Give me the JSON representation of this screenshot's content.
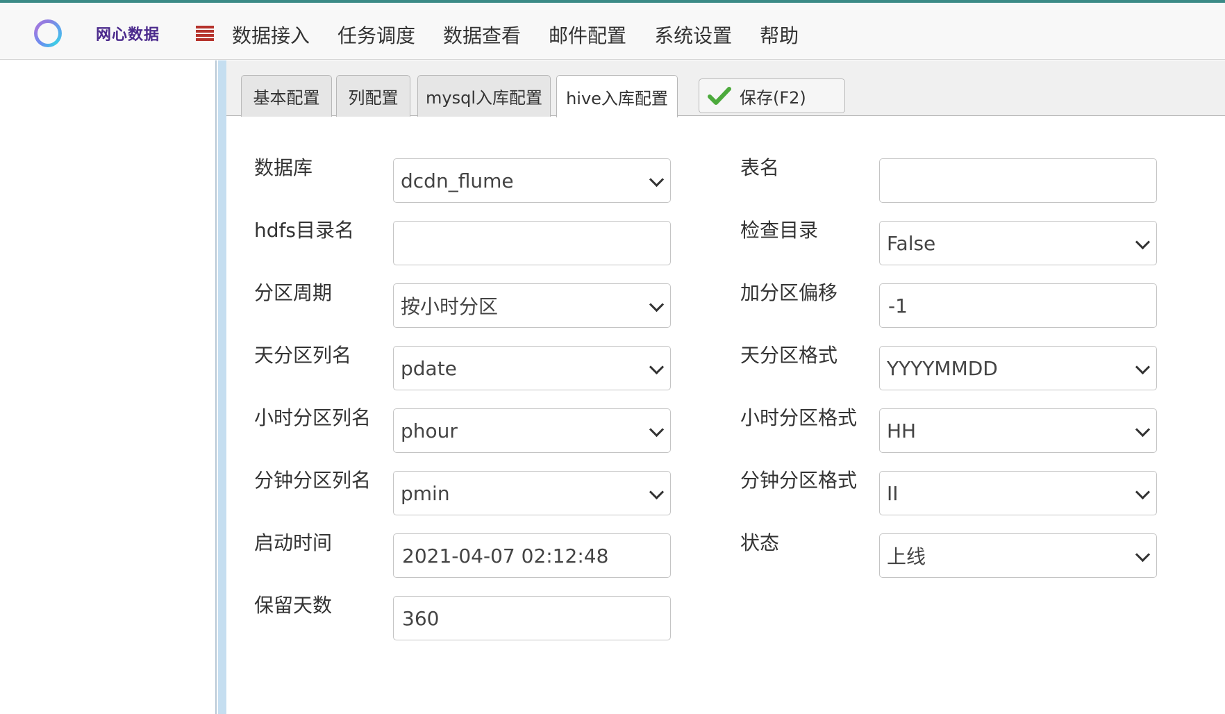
{
  "header": {
    "brand": "网心数据",
    "nav": [
      "数据接入",
      "任务调度",
      "数据查看",
      "邮件配置",
      "系统设置",
      "帮助"
    ]
  },
  "tabs": [
    {
      "label": "基本配置",
      "active": false
    },
    {
      "label": "列配置",
      "active": false
    },
    {
      "label": "mysql入库配置",
      "active": false
    },
    {
      "label": "hive入库配置",
      "active": true
    }
  ],
  "save_button": {
    "label": "保存(F2)"
  },
  "form": {
    "database": {
      "label": "数据库",
      "value": "dcdn_flume"
    },
    "table_name": {
      "label": "表名",
      "value": ""
    },
    "hdfs_dir": {
      "label": "hdfs目录名",
      "value": ""
    },
    "check_dir": {
      "label": "检查目录",
      "value": "False"
    },
    "partition_period": {
      "label": "分区周期",
      "value": "按小时分区"
    },
    "partition_offset": {
      "label": "加分区偏移",
      "value": "-1"
    },
    "day_partition_col": {
      "label": "天分区列名",
      "value": "pdate"
    },
    "day_partition_fmt": {
      "label": "天分区格式",
      "value": "YYYYMMDD"
    },
    "hour_partition_col": {
      "label": "小时分区列名",
      "value": "phour"
    },
    "hour_partition_fmt": {
      "label": "小时分区格式",
      "value": "HH"
    },
    "minute_partition_col": {
      "label": "分钟分区列名",
      "value": "pmin"
    },
    "minute_partition_fmt": {
      "label": "分钟分区格式",
      "value": "II"
    },
    "start_time": {
      "label": "启动时间",
      "value": "2021-04-07 02:12:48"
    },
    "status": {
      "label": "状态",
      "value": "上线"
    },
    "retention_days": {
      "label": "保留天数",
      "value": "360"
    }
  },
  "colors": {
    "accent": "#3b8a86",
    "brand": "#4b2a8c",
    "menu_icon": "#b5322b",
    "check_icon": "#4caa3c"
  }
}
